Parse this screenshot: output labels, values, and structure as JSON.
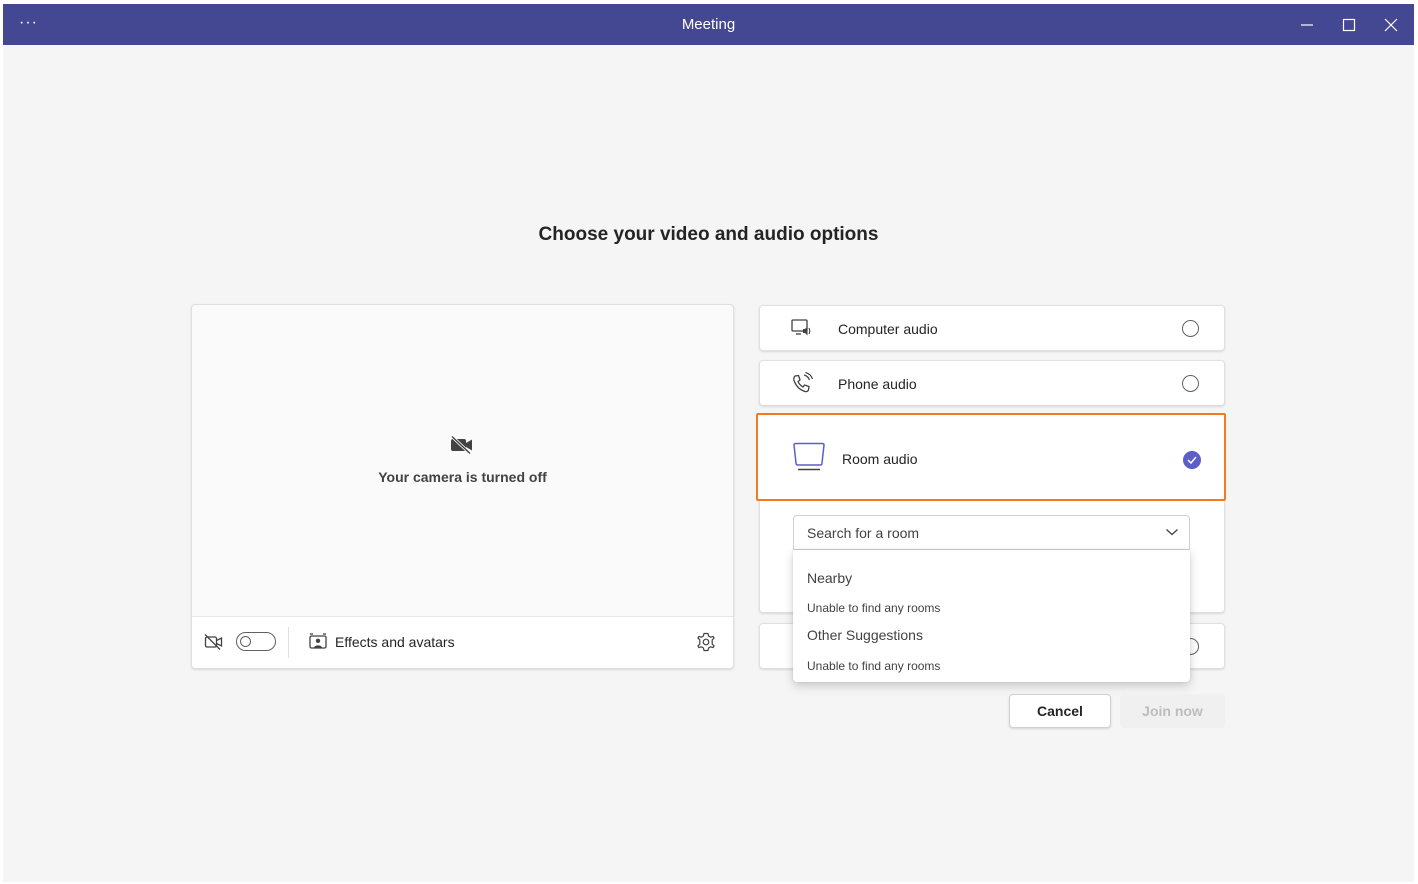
{
  "window": {
    "title": "Meeting",
    "more_label": "···",
    "accent_color": "#444791"
  },
  "heading": "Choose your video and audio options",
  "preview": {
    "camera_off_text": "Your camera is turned off",
    "camera_toggle_on": false,
    "effects_label": "Effects and avatars"
  },
  "audio_options": [
    {
      "label": "Computer audio",
      "icon": "computer-audio-icon",
      "selected": false
    },
    {
      "label": "Phone audio",
      "icon": "phone-audio-icon",
      "selected": false
    },
    {
      "label": "Room audio",
      "icon": "room-audio-icon",
      "selected": true
    }
  ],
  "room_search": {
    "placeholder": "Search for a room",
    "groups": [
      {
        "header": "Nearby",
        "message": "Unable to find any rooms"
      },
      {
        "header": "Other Suggestions",
        "message": "Unable to find any rooms"
      }
    ]
  },
  "actions": {
    "cancel_label": "Cancel",
    "join_label": "Join now",
    "join_enabled": false
  },
  "colors": {
    "selected_check": "#5b5fc7",
    "highlight_border": "#f7781e"
  }
}
